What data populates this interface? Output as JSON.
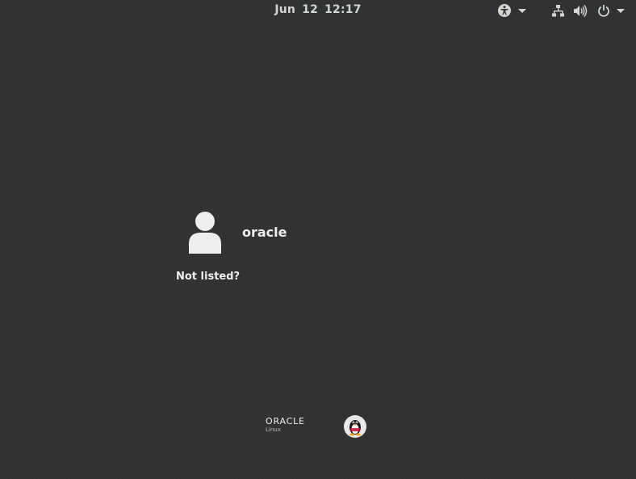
{
  "topbar": {
    "date": "Jun 12",
    "time": "12:17"
  },
  "users": [
    {
      "name": "oracle",
      "avatar_icon": "user-silhouette-icon"
    }
  ],
  "not_listed_label": "Not listed?",
  "branding": {
    "vendor": "ORACLE",
    "product": "Linux"
  },
  "icons": {
    "accessibility": "accessibility-icon",
    "network": "network-wired-icon",
    "volume": "volume-icon",
    "power": "power-icon"
  },
  "colors": {
    "background": "#303234",
    "text": "#eeeeec",
    "topbar_text": "#d3d7cf"
  }
}
